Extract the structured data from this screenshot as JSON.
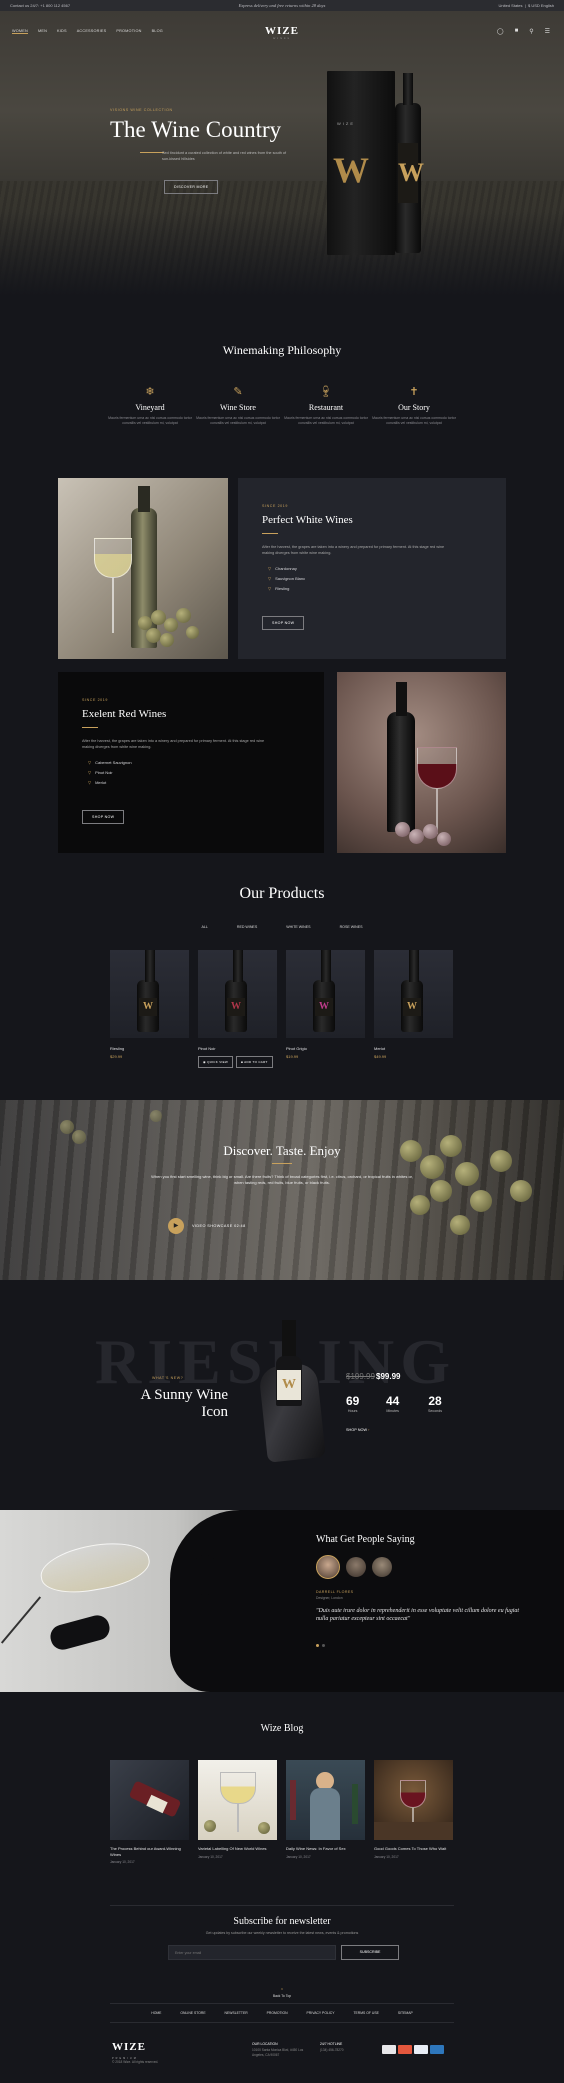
{
  "topbar": {
    "contact": "Contact us 24/7: +1 800 112 4567",
    "promo": "Express delivery and free returns within 28 days",
    "account": "United States",
    "language": "$ USD English"
  },
  "nav": {
    "items": [
      "WOMEN",
      "MEN",
      "KIDS",
      "ACCESSORIES",
      "PROMOTION",
      "BLOG"
    ],
    "logo": "WIZE",
    "logo_sub": "WINES",
    "icons": [
      "user-icon",
      "cart-icon",
      "search-icon",
      "menu-icon"
    ]
  },
  "hero": {
    "eyebrow": "VISIONS WINE COLLECTION",
    "title": "The Wine Country",
    "text": "Sed tincidunt a curated collection of white and red wines from the south of sun-kissed hillsides",
    "button": "DISCOVER MORE",
    "box_label": "WIZE",
    "bottle_label": "W"
  },
  "philosophy": {
    "title": "Winemaking Philosophy",
    "items": [
      {
        "icon": "grapes-icon",
        "title": "Vineyard",
        "text": "Mauris fermentum urna ac nisi cursus commodo tortor convallis vel vestibulum mi, volutpat"
      },
      {
        "icon": "corkscrew-icon",
        "title": "Wine Store",
        "text": "Mauris fermentum urna ac nisi cursus commodo tortor convallis vel vestibulum mi, volutpat"
      },
      {
        "icon": "wine-glass-icon",
        "title": "Restaurant",
        "text": "Mauris fermentum urna ac nisi cursus commodo tortor convallis vel vestibulum mi, volutpat"
      },
      {
        "icon": "corkscrew-icon",
        "title": "Our Story",
        "text": "Mauris fermentum urna ac nisi cursus commodo tortor convallis vel vestibulum mi, volutpat"
      }
    ]
  },
  "white_wines": {
    "eyebrow": "SINCE 2019",
    "title": "Perfect White Wines",
    "text": "After the harvest, the grapes are taken into a winery and prepared for primary ferment. At this stage red wine making diverges from white wine making.",
    "list": [
      "Chardonnay",
      "Sauvignon Blanc",
      "Riesling"
    ],
    "button": "SHOP NOW"
  },
  "red_wines": {
    "eyebrow": "SINCE 2019",
    "title": "Exelent Red Wines",
    "text": "After the harvest, the grapes are taken into a winery and prepared for primary ferment. At this stage red wine making diverges from white wine making.",
    "list": [
      "Cabernet Sauvignon",
      "Pinot Noir",
      "Merlot"
    ],
    "button": "SHOP NOW"
  },
  "products": {
    "title": "Our Products",
    "tabs": [
      "ALL",
      "RED WINES",
      "WHITE WINES",
      "ROSE WINES"
    ],
    "items": [
      {
        "name": "Riesling",
        "price": "$29.99",
        "accent": "#c8a15c"
      },
      {
        "name": "Pinot Noir",
        "price": "$39.99",
        "accent": "#b0364a"
      },
      {
        "name": "Pinot Grigio",
        "price": "$19.99",
        "accent": "#c03c8c"
      },
      {
        "name": "Merlot",
        "price": "$49.99",
        "accent": "#c8a15c"
      }
    ],
    "quick_view": "QUICK VIEW",
    "add_to_cart": "ADD TO CART"
  },
  "discover": {
    "title": "Discover. Taste. Enjoy",
    "text": "When you first start smelling wine, think big or small. Are there fruits? Think of broad categories first, i.e. citrus, orchard, or tropical fruits in whites or, when tasting reds, red fruits, blue fruits, or black fruits.",
    "video_label": "VIDEO SHOWCASE 02:48"
  },
  "deal": {
    "watermark": "RIESLING",
    "eyebrow": "WHAT'S NEW?",
    "title": "A Sunny Wine Icon",
    "old_price": "$109.99",
    "price": "$99.99",
    "timer": [
      {
        "value": "69",
        "unit": "Hours"
      },
      {
        "value": "44",
        "unit": "Minutes"
      },
      {
        "value": "28",
        "unit": "Seconds"
      }
    ],
    "link": "SHOP NOW"
  },
  "testimonials": {
    "title": "What Get People Saying",
    "name": "DARRELL FLORES",
    "role": "Designer, London",
    "quote": "\"Duis aute irure dolor in reprehenderit in esse voluptate velit cillum dolore eu fugiat nulla pariatur excepteur sint occaecat\""
  },
  "blog": {
    "title": "Wize Blog",
    "posts": [
      {
        "title": "The Process Behind our Award-Winning Wines",
        "date": "January 10, 2017"
      },
      {
        "title": "Varietal Labelling Of New World Wines",
        "date": "January 10, 2017"
      },
      {
        "title": "Daily Wine News: In Favor of Sex",
        "date": "January 10, 2017"
      },
      {
        "title": "Good Goods Comes To Those Who Wait",
        "date": "January 10, 2017"
      }
    ]
  },
  "newsletter": {
    "title": "Subscribe for newsletter",
    "text": "Get updates by subscribe our weekly newsletter to receive the latest news, events & promotions",
    "placeholder": "Enter your email",
    "button": "SUBSCRIBE"
  },
  "footer": {
    "back_to_top": "Back To Top",
    "links": [
      "HOME",
      "ONLINE STORE",
      "NEWSLETTER",
      "PROMOTION",
      "PRIVACY POLICY",
      "TERMS OF USE",
      "SITEMAP"
    ],
    "logo": "WIZE",
    "logo_sub": "PREMIUM",
    "copyright": "© 2018 Wize. All rights reserved.",
    "location_label": "OUR LOCATION",
    "location": "10100 Santa Monica Blvd, #450 Los Angeles, CA 90067",
    "phone_label": "24/7 HOTLINE",
    "phone": "(134) 456-78270",
    "payments": [
      "visa",
      "mastercard",
      "paypal",
      "amex"
    ]
  }
}
